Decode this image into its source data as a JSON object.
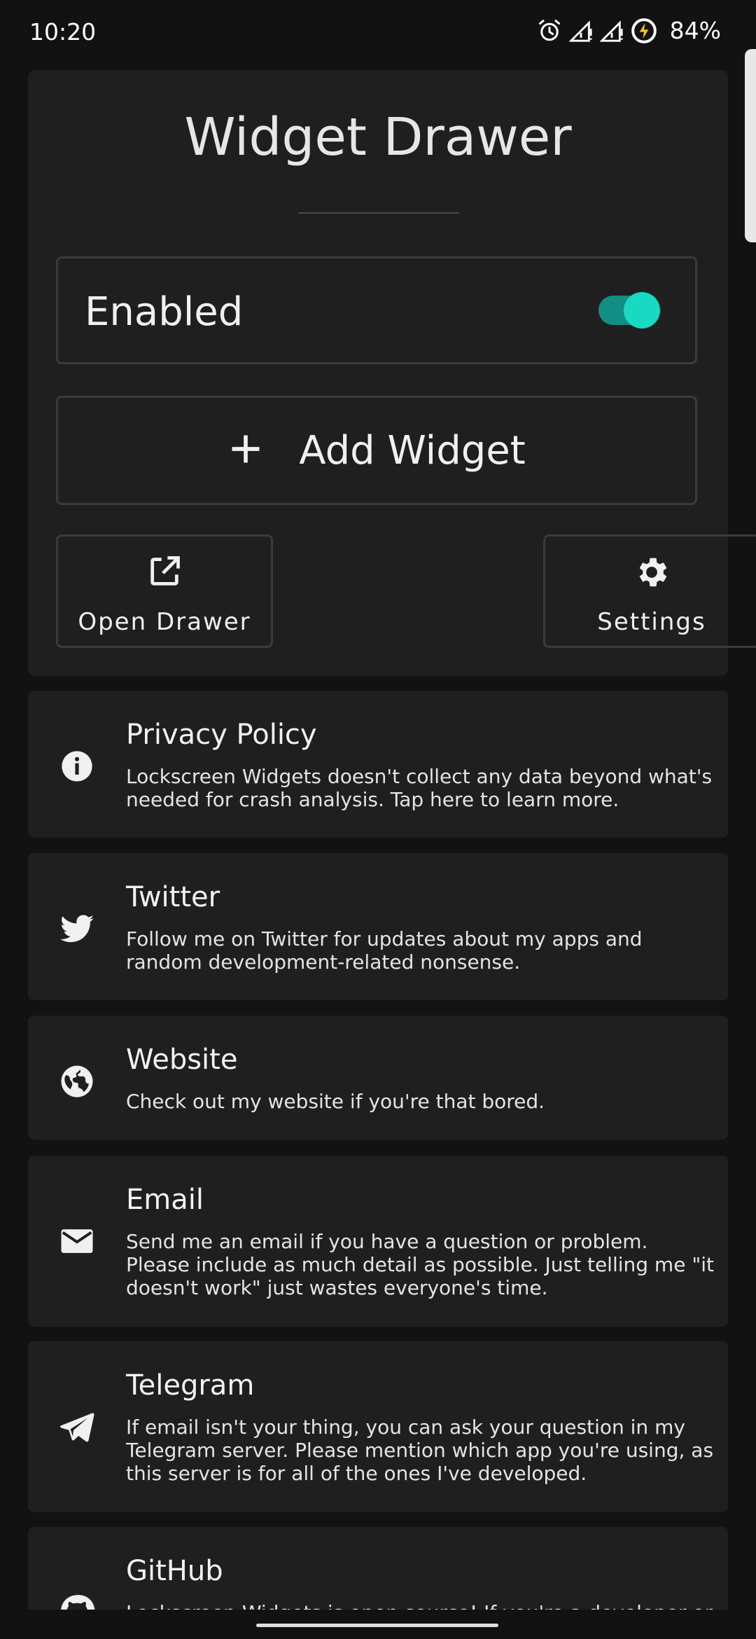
{
  "status_bar": {
    "time": "10:20",
    "battery": "84%",
    "icons": [
      "alarm-icon",
      "signal-icon",
      "signal-icon",
      "battery-charging-icon"
    ]
  },
  "main": {
    "title": "Widget Drawer",
    "enabled_label": "Enabled",
    "enabled_on": true,
    "add_widget_label": "Add Widget",
    "open_drawer_label": "Open Drawer",
    "settings_label": "Settings"
  },
  "cards": [
    {
      "title": "Privacy Policy",
      "description": "Lockscreen Widgets doesn't collect any data beyond what's needed for crash analysis. Tap here to learn more.",
      "icon": "info-icon"
    },
    {
      "title": "Twitter",
      "description": "Follow me on Twitter for updates about my apps and random development-related nonsense.",
      "icon": "twitter-icon"
    },
    {
      "title": "Website",
      "description": "Check out my website if you're that bored.",
      "icon": "globe-icon"
    },
    {
      "title": "Email",
      "description": "Send me an email if you have a question or problem. Please include as much detail as possible. Just telling me \"it doesn't work\" just wastes everyone's time.",
      "icon": "email-icon"
    },
    {
      "title": "Telegram",
      "description": "If email isn't your thing, you can ask your question in my Telegram server. Please mention which app you're using, as this server is for all of the ones I've developed.",
      "icon": "telegram-icon"
    },
    {
      "title": "GitHub",
      "description": "Lockscreen Widgets is open source! If you're a developer or",
      "icon": "github-icon"
    }
  ],
  "colors": {
    "background": "#121212",
    "card": "#1f1f1f",
    "accent": "#18d9c2",
    "accent_track": "#128f83"
  }
}
